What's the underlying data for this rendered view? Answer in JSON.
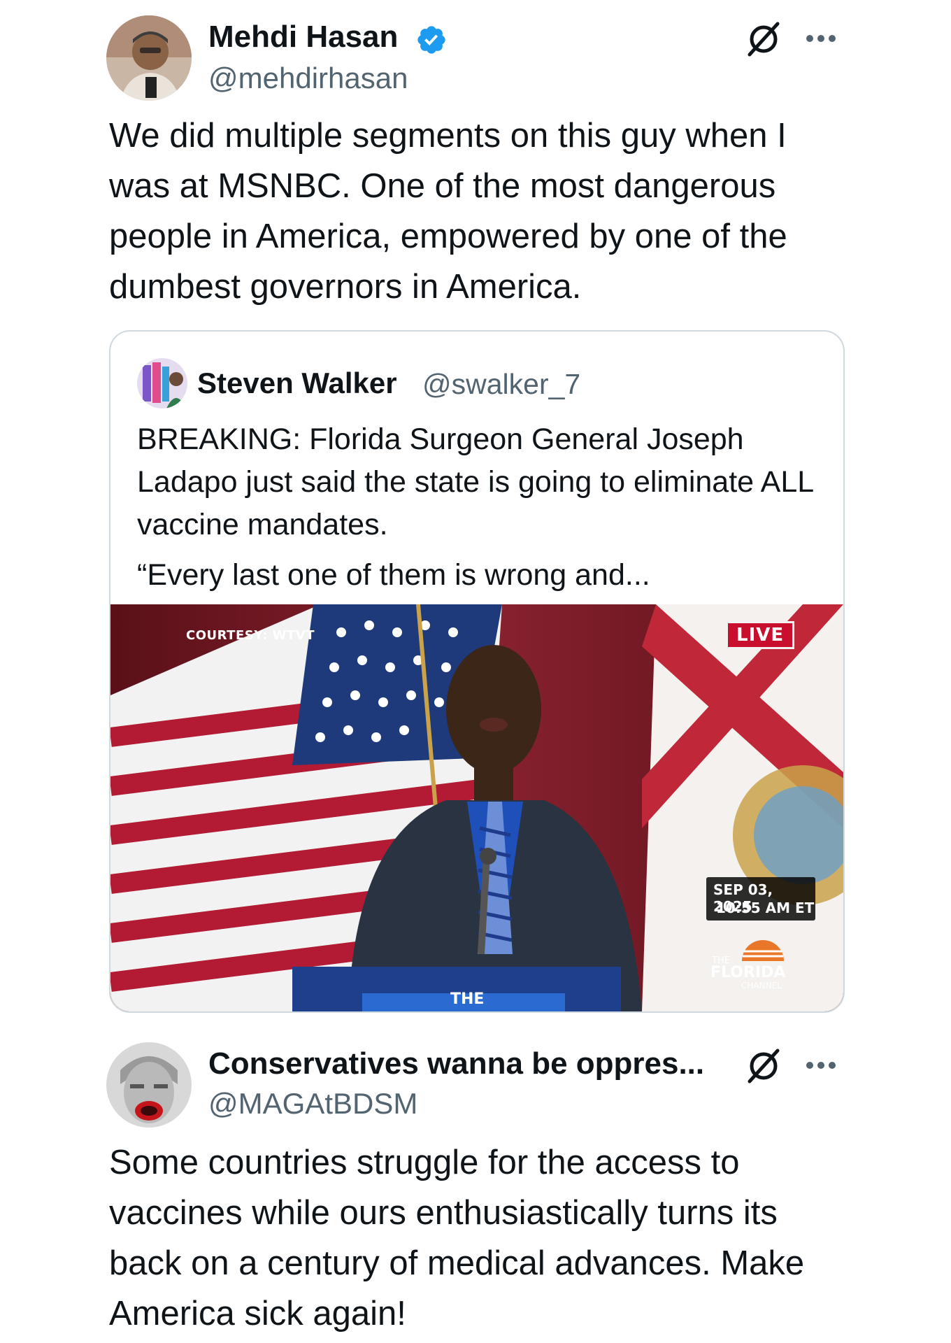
{
  "tweet1": {
    "display_name": "Mehdi Hasan",
    "handle": "@mehdirhasan",
    "verified": true,
    "text": "We did multiple segments on this guy when I was at MSNBC. One of the most dangerous people in America, empowered by one of the dumbest governors in America."
  },
  "quote": {
    "display_name": "Steven Walker",
    "handle": "@swalker_7",
    "text": "BREAKING: Florida Surgeon General Joseph Ladapo just said the state is going to eliminate ALL vaccine mandates.",
    "text2": "“Every last one of them is wrong and...",
    "media": {
      "courtesy": "COURTESY: WTVT",
      "live": "LIVE",
      "date": "SEP 03, 2025",
      "time": "10:55 AM ET",
      "logo_the": "THE",
      "logo_name": "FLORIDA",
      "logo_sub": "CHANNEL",
      "podium": "THE"
    }
  },
  "tweet2": {
    "display_name": "Conservatives wanna be oppres...",
    "handle": "@MAGAtBDSM",
    "text": "Some countries struggle for the access to vaccines while ours enthusiastically turns its back on a century of medical advances. Make America sick again!"
  },
  "colors": {
    "text": "#0f1419",
    "secondary": "#536471",
    "verified": "#1d9bf0",
    "border": "#cfd9de",
    "live_red": "#c8102e"
  },
  "icons": [
    "verified-badge-icon",
    "grok-slash-icon",
    "more-options-icon"
  ]
}
